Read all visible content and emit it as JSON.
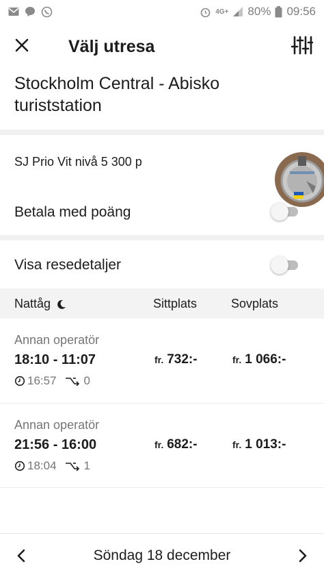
{
  "status_bar": {
    "battery": "80%",
    "time": "09:56",
    "network": "4G+"
  },
  "header": {
    "title": "Välj utresa"
  },
  "route": "Stockholm Central - Abisko turiststation",
  "prio": {
    "label": "SJ Prio Vit nivå 5 300 p"
  },
  "pay_with_points": {
    "label": "Betala med poäng",
    "enabled": false
  },
  "show_details": {
    "label": "Visa resedetaljer",
    "enabled": false
  },
  "table": {
    "col_train": "Nattåg",
    "col_seat": "Sittplats",
    "col_sleeper": "Sovplats"
  },
  "trips": [
    {
      "operator": "Annan operatör",
      "times": "18:10 - 11:07",
      "duration": "16:57",
      "changes": "0",
      "seat_prefix": "fr.",
      "seat_price": "732:-",
      "sleeper_prefix": "fr.",
      "sleeper_price": "1 066:-"
    },
    {
      "operator": "Annan operatör",
      "times": "21:56 - 16:00",
      "duration": "18:04",
      "changes": "1",
      "seat_prefix": "fr.",
      "seat_price": "682:-",
      "sleeper_prefix": "fr.",
      "sleeper_price": "1 013:-"
    }
  ],
  "footer": {
    "date": "Söndag 18 december"
  },
  "colors": {
    "text": "#1c1c1c",
    "muted": "#767676",
    "divider": "#f1f1f1"
  },
  "icons": [
    "close-icon",
    "filter-sliders-icon",
    "moon-icon",
    "clock-icon",
    "transfer-icon",
    "chevron-left-icon",
    "chevron-right-icon"
  ]
}
